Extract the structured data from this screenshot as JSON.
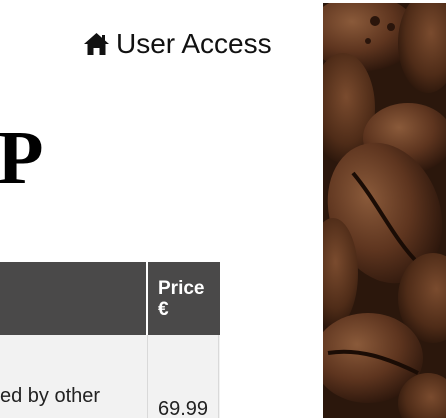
{
  "header": {
    "user_access_label": "User Access",
    "user_access_icon": "home-icon"
  },
  "shop": {
    "title": "OP"
  },
  "table": {
    "header_bg": "#4a4949",
    "columns": [
      {
        "label": ""
      },
      {
        "label": "Price\n€"
      }
    ],
    "rows": [
      {
        "description": "ed by other",
        "price": "69.99"
      }
    ]
  },
  "image": {
    "subject": "coffee-beans"
  }
}
